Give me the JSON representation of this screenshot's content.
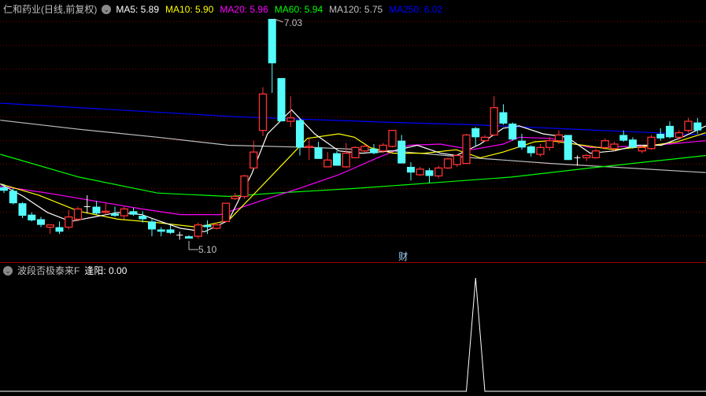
{
  "header": {
    "title": "仁和药业(日线,前复权)",
    "ma": [
      {
        "label": "MA5: 5.89",
        "color": "#ffffff"
      },
      {
        "label": "MA10: 5.90",
        "color": "#ffff00"
      },
      {
        "label": "MA20: 5.96",
        "color": "#ff00ff"
      },
      {
        "label": "MA60: 5.94",
        "color": "#00ff00"
      },
      {
        "label": "MA120: 5.75",
        "color": "#c0c0c0"
      },
      {
        "label": "MA250: 6.02",
        "color": "#0000ff"
      }
    ]
  },
  "annotations": {
    "high": "7.03",
    "low": "5.10",
    "finance_marker": "财"
  },
  "indicator": {
    "title": "波段否极泰来F",
    "value_label": "逢阳: 0.00"
  },
  "colors": {
    "up": "#ff3232",
    "down": "#54fcfc",
    "flat": "#ffffff",
    "grid": "#800000",
    "divider": "#a00000"
  },
  "chart_data": {
    "type": "candlestick",
    "price_range": [
      5.1,
      7.03
    ],
    "candles_ohlc": [
      [
        5.55,
        5.58,
        5.5,
        5.52
      ],
      [
        5.52,
        5.54,
        5.4,
        5.41
      ],
      [
        5.41,
        5.42,
        5.28,
        5.3
      ],
      [
        5.31,
        5.33,
        5.25,
        5.26
      ],
      [
        5.27,
        5.29,
        5.2,
        5.22
      ],
      [
        5.2,
        5.22,
        5.14,
        5.22
      ],
      [
        5.2,
        5.25,
        5.14,
        5.16
      ],
      [
        5.2,
        5.35,
        5.18,
        5.29
      ],
      [
        5.27,
        5.38,
        5.25,
        5.36
      ],
      [
        5.38,
        5.48,
        5.32,
        5.38
      ],
      [
        5.38,
        5.43,
        5.31,
        5.32
      ],
      [
        5.33,
        5.41,
        5.31,
        5.34
      ],
      [
        5.32,
        5.38,
        5.29,
        5.3
      ],
      [
        5.3,
        5.38,
        5.27,
        5.36
      ],
      [
        5.34,
        5.37,
        5.3,
        5.31
      ],
      [
        5.3,
        5.34,
        5.24,
        5.27
      ],
      [
        5.25,
        5.27,
        5.12,
        5.18
      ],
      [
        5.18,
        5.2,
        5.12,
        5.16
      ],
      [
        5.18,
        5.22,
        5.14,
        5.15
      ],
      [
        5.13,
        5.16,
        5.09,
        5.13
      ],
      [
        5.12,
        5.13,
        5.1,
        5.1
      ],
      [
        5.12,
        5.24,
        5.1,
        5.22
      ],
      [
        5.22,
        5.26,
        5.14,
        5.2
      ],
      [
        5.19,
        5.24,
        5.18,
        5.22
      ],
      [
        5.25,
        5.41,
        5.25,
        5.41
      ],
      [
        5.45,
        5.5,
        5.44,
        5.47
      ],
      [
        5.47,
        5.66,
        5.45,
        5.65
      ],
      [
        5.72,
        5.96,
        5.72,
        5.86
      ],
      [
        6.05,
        6.43,
        6.0,
        6.37
      ],
      [
        7.03,
        7.03,
        6.38,
        6.64
      ],
      [
        6.51,
        6.51,
        6.13,
        6.13
      ],
      [
        6.13,
        6.35,
        6.08,
        6.16
      ],
      [
        6.14,
        6.16,
        5.83,
        5.9
      ],
      [
        5.9,
        5.98,
        5.79,
        5.91
      ],
      [
        5.9,
        5.95,
        5.8,
        5.8
      ],
      [
        5.73,
        5.86,
        5.73,
        5.79
      ],
      [
        5.85,
        5.87,
        5.74,
        5.74
      ],
      [
        5.73,
        5.94,
        5.72,
        5.85
      ],
      [
        5.81,
        5.91,
        5.81,
        5.9
      ],
      [
        5.87,
        5.93,
        5.86,
        5.91
      ],
      [
        5.89,
        5.93,
        5.84,
        5.85
      ],
      [
        5.87,
        5.94,
        5.85,
        5.92
      ],
      [
        5.91,
        6.05,
        5.9,
        6.05
      ],
      [
        5.96,
        6.01,
        5.76,
        5.76
      ],
      [
        5.73,
        5.77,
        5.61,
        5.68
      ],
      [
        5.66,
        5.73,
        5.65,
        5.71
      ],
      [
        5.7,
        5.72,
        5.59,
        5.65
      ],
      [
        5.65,
        5.74,
        5.63,
        5.72
      ],
      [
        5.72,
        5.81,
        5.71,
        5.8
      ],
      [
        5.75,
        5.84,
        5.73,
        5.83
      ],
      [
        5.76,
        6.02,
        5.76,
        6.01
      ],
      [
        6.07,
        6.08,
        5.91,
        5.99
      ],
      [
        5.96,
        6.01,
        5.95,
        5.99
      ],
      [
        6.01,
        6.35,
        6.0,
        6.25
      ],
      [
        6.21,
        6.28,
        6.1,
        6.11
      ],
      [
        6.11,
        6.12,
        5.96,
        5.97
      ],
      [
        5.96,
        6.02,
        5.88,
        5.9
      ],
      [
        5.91,
        5.92,
        5.82,
        5.85
      ],
      [
        5.84,
        5.93,
        5.82,
        5.9
      ],
      [
        5.9,
        5.99,
        5.87,
        5.96
      ],
      [
        5.96,
        6.05,
        5.93,
        6.01
      ],
      [
        6.01,
        6.01,
        5.79,
        5.79
      ],
      [
        5.81,
        5.83,
        5.74,
        5.81
      ],
      [
        5.81,
        5.84,
        5.78,
        5.83
      ],
      [
        5.81,
        5.89,
        5.8,
        5.87
      ],
      [
        5.9,
        5.98,
        5.88,
        5.96
      ],
      [
        5.89,
        5.95,
        5.87,
        5.93
      ],
      [
        6.01,
        6.05,
        5.95,
        5.96
      ],
      [
        5.97,
        5.99,
        5.89,
        5.9
      ],
      [
        5.87,
        5.92,
        5.85,
        5.9
      ],
      [
        5.89,
        6.01,
        5.88,
        5.99
      ],
      [
        6.02,
        6.07,
        5.96,
        5.98
      ],
      [
        6.09,
        6.13,
        5.98,
        5.99
      ],
      [
        5.99,
        6.05,
        5.97,
        6.03
      ],
      [
        6.05,
        6.16,
        6.03,
        6.13
      ],
      [
        6.12,
        6.16,
        6.02,
        6.05
      ]
    ],
    "high_index": 29,
    "low_index": 20,
    "finance_marker_index": 43,
    "moving_averages": [
      {
        "name": "MA250",
        "color": "#0000ff",
        "points": [
          [
            -0.4,
            6.29
          ],
          [
            25.1,
            6.17
          ],
          [
            42.1,
            6.12
          ],
          [
            50.6,
            6.1
          ],
          [
            75.9,
            6.01
          ]
        ]
      },
      {
        "name": "MA120",
        "color": "#c0c0c0",
        "points": [
          [
            -0.4,
            6.14
          ],
          [
            8.1,
            6.06
          ],
          [
            16.6,
            5.99
          ],
          [
            24.3,
            5.92
          ],
          [
            33.6,
            5.9
          ],
          [
            42.1,
            5.87
          ],
          [
            50.6,
            5.81
          ],
          [
            59.1,
            5.76
          ],
          [
            75.9,
            5.68
          ]
        ]
      },
      {
        "name": "MA60",
        "color": "#00ff00",
        "points": [
          [
            -0.4,
            5.84
          ],
          [
            8.1,
            5.64
          ],
          [
            16.6,
            5.5
          ],
          [
            24.3,
            5.47
          ],
          [
            29.4,
            5.5
          ],
          [
            37.9,
            5.54
          ],
          [
            46.4,
            5.59
          ],
          [
            54.9,
            5.64
          ],
          [
            63.4,
            5.72
          ],
          [
            75.9,
            5.83
          ]
        ]
      },
      {
        "name": "MA20",
        "color": "#ff00ff",
        "points": [
          [
            -0.4,
            5.56
          ],
          [
            4.7,
            5.5
          ],
          [
            9.8,
            5.43
          ],
          [
            14.9,
            5.36
          ],
          [
            19.1,
            5.31
          ],
          [
            23.4,
            5.31
          ],
          [
            27.7,
            5.43
          ],
          [
            31.9,
            5.54
          ],
          [
            36.2,
            5.66
          ],
          [
            40.4,
            5.81
          ],
          [
            43.8,
            5.92
          ],
          [
            47.2,
            5.93
          ],
          [
            50.6,
            5.88
          ],
          [
            54.0,
            5.93
          ],
          [
            55.7,
            5.99
          ],
          [
            59.1,
            5.98
          ],
          [
            63.4,
            5.9
          ],
          [
            67.7,
            5.91
          ],
          [
            71.9,
            5.93
          ],
          [
            75.9,
            5.96
          ]
        ]
      },
      {
        "name": "MA10",
        "color": "#ffff00",
        "points": [
          [
            -0.4,
            5.58
          ],
          [
            3.8,
            5.48
          ],
          [
            8.1,
            5.34
          ],
          [
            12.3,
            5.27
          ],
          [
            16.6,
            5.24
          ],
          [
            20.9,
            5.2
          ],
          [
            24.3,
            5.26
          ],
          [
            26.8,
            5.47
          ],
          [
            29.4,
            5.69
          ],
          [
            32.8,
            5.98
          ],
          [
            36.2,
            6.02
          ],
          [
            37.9,
            5.99
          ],
          [
            39.6,
            5.9
          ],
          [
            42.1,
            5.85
          ],
          [
            45.5,
            5.85
          ],
          [
            48.9,
            5.88
          ],
          [
            51.5,
            5.81
          ],
          [
            54.0,
            5.86
          ],
          [
            57.4,
            5.95
          ],
          [
            59.1,
            5.96
          ],
          [
            62.6,
            5.92
          ],
          [
            66.0,
            5.88
          ],
          [
            69.4,
            5.91
          ],
          [
            72.8,
            5.95
          ],
          [
            75.9,
            6.03
          ]
        ]
      },
      {
        "name": "MA5",
        "color": "#ffffff",
        "points": [
          [
            -0.4,
            5.58
          ],
          [
            2.1,
            5.47
          ],
          [
            4.7,
            5.33
          ],
          [
            7.2,
            5.25
          ],
          [
            9.8,
            5.29
          ],
          [
            12.3,
            5.33
          ],
          [
            14.9,
            5.31
          ],
          [
            16.6,
            5.26
          ],
          [
            19.1,
            5.19
          ],
          [
            21.7,
            5.16
          ],
          [
            24.3,
            5.26
          ],
          [
            26.8,
            5.67
          ],
          [
            28.5,
            6.02
          ],
          [
            31.1,
            6.23
          ],
          [
            33.6,
            6.02
          ],
          [
            36.2,
            5.87
          ],
          [
            38.7,
            5.85
          ],
          [
            42.1,
            5.87
          ],
          [
            44.7,
            5.92
          ],
          [
            47.2,
            5.85
          ],
          [
            48.9,
            5.83
          ],
          [
            51.5,
            5.93
          ],
          [
            54.0,
            6.07
          ],
          [
            55.7,
            6.09
          ],
          [
            58.3,
            6.02
          ],
          [
            60.9,
            5.99
          ],
          [
            63.4,
            5.85
          ],
          [
            66.0,
            5.87
          ],
          [
            68.5,
            5.92
          ],
          [
            71.1,
            5.92
          ],
          [
            73.6,
            6.0
          ],
          [
            75.9,
            6.09
          ]
        ]
      }
    ],
    "indicator_series": {
      "name": "逢阳",
      "range": [
        0,
        1
      ],
      "nonzero": [
        [
          51,
          1
        ]
      ]
    }
  }
}
